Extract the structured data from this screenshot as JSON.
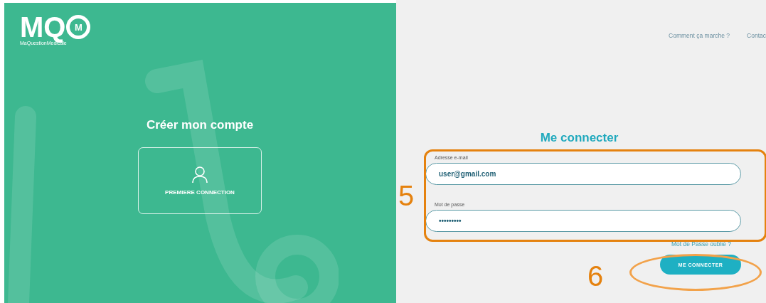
{
  "logo": {
    "mark": "MQ",
    "mark_inner": "M",
    "name": "MaQuestionMedicale"
  },
  "nav": {
    "items": [
      "Comment ça marche ?",
      "Contac"
    ]
  },
  "signup": {
    "title": "Créer mon compte",
    "button": "PREMIERE CONNECTION"
  },
  "login": {
    "title": "Me connecter",
    "fields": [
      {
        "label": "Adresse e-mail",
        "value": "user@gmail.com"
      },
      {
        "label": "Mot de passe",
        "value": "•••••••••"
      }
    ],
    "forgot_link": "Mot de Passe oublié ?",
    "submit": "ME CONNECTER"
  },
  "annotations": [
    {
      "label": "5",
      "kind": "box"
    },
    {
      "label": "6",
      "kind": "ellipse"
    }
  ]
}
